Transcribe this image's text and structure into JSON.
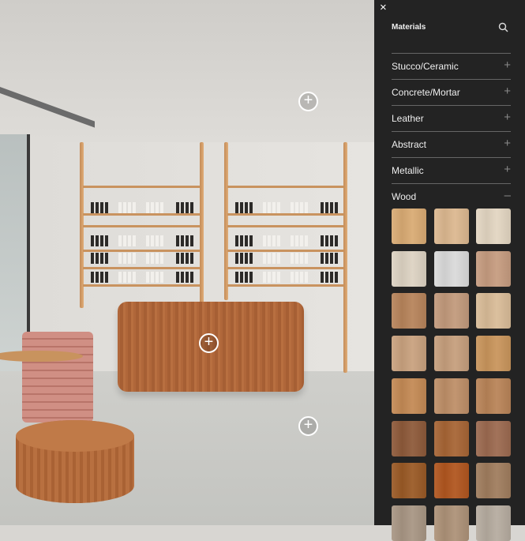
{
  "panel": {
    "close_icon": "×",
    "title": "Materials",
    "search_icon": "search-icon",
    "categories": [
      {
        "label": "Stucco/Ceramic",
        "state": "+"
      },
      {
        "label": "Concrete/Mortar",
        "state": "+"
      },
      {
        "label": "Leather",
        "state": "+"
      },
      {
        "label": "Abstract",
        "state": "+"
      },
      {
        "label": "Metallic",
        "state": "+"
      },
      {
        "label": "Wood",
        "state": "–"
      }
    ],
    "wood_swatches": [
      "#d9ab74",
      "#dcb890",
      "#e3d6c2",
      "#ddd3c3",
      "#dadada",
      "#c69c80",
      "#b7845b",
      "#c29a7c",
      "#d9bc98",
      "#c9a27f",
      "#c69f7d",
      "#c9955c",
      "#c48a55",
      "#be8f68",
      "#b98458",
      "#8e5a3a",
      "#a76535",
      "#9c6a50",
      "#9a5a26",
      "#b1561f",
      "#a07d5e",
      "#a89684",
      "#ad9278",
      "#b6aca0"
    ]
  },
  "hotspots": [
    "+",
    "+",
    "+"
  ]
}
